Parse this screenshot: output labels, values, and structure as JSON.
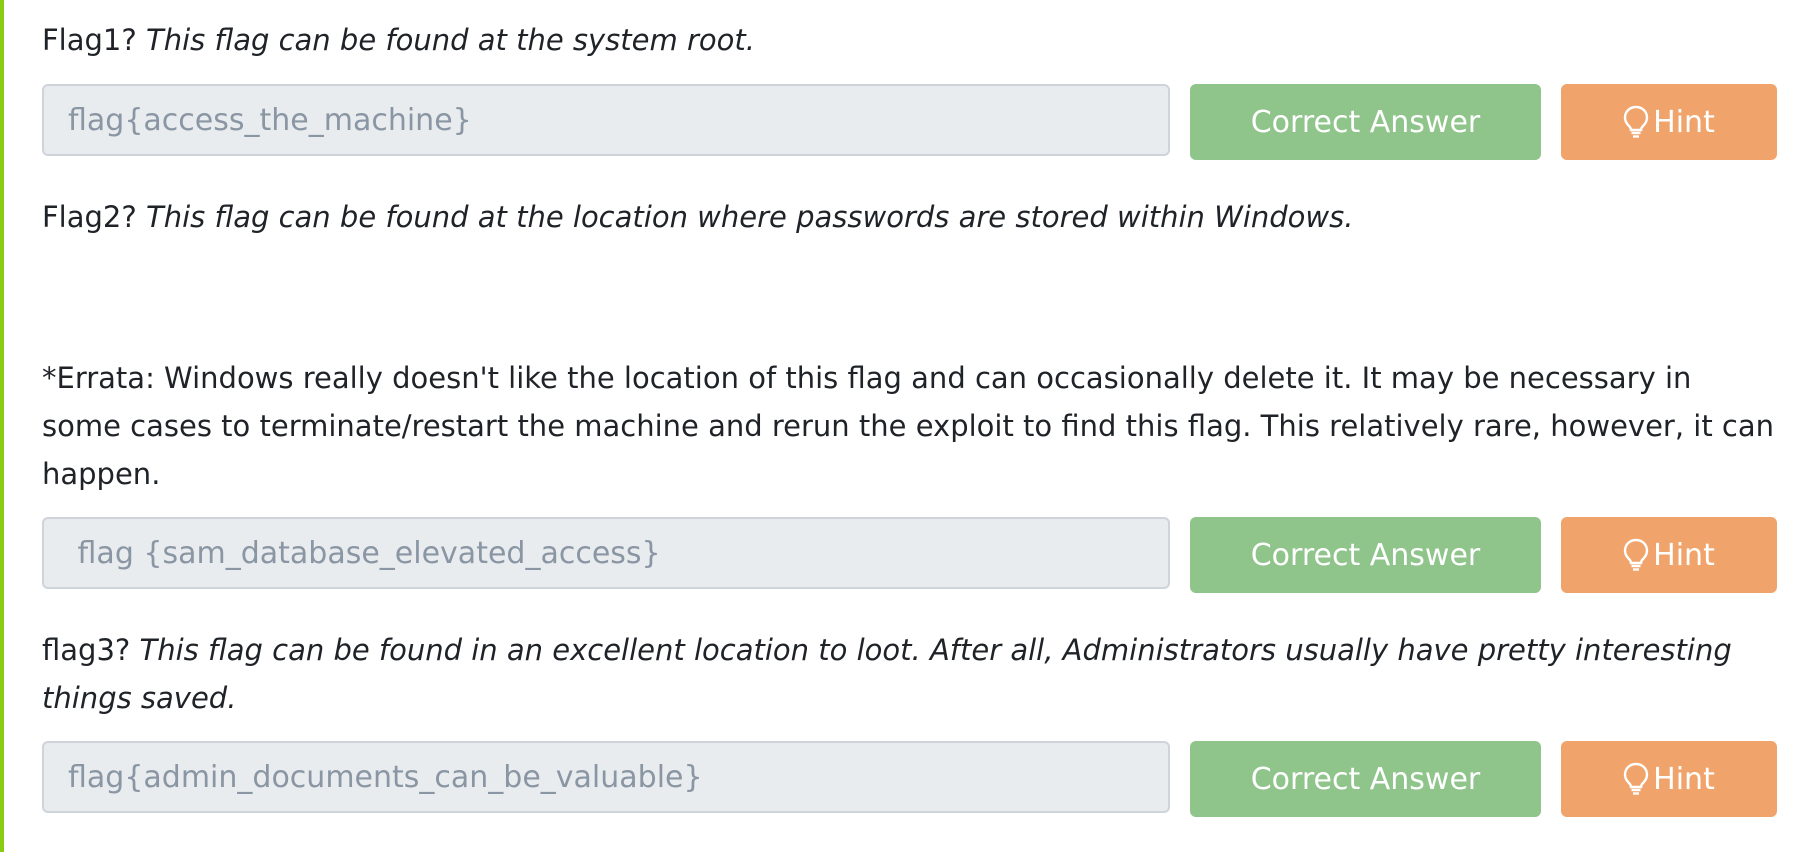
{
  "colors": {
    "accent_bar": "#88cc14",
    "correct_button": "#8fc48b",
    "hint_button": "#f0a46c",
    "input_bg": "#e9ecef",
    "input_text": "#8a96a3"
  },
  "questions": [
    {
      "label": "Flag1?",
      "text": "This flag can be found at the system root.",
      "answer": "flag{access_the_machine}",
      "correct_label": "Correct Answer",
      "hint_label": "Hint",
      "hint_icon": "lightbulb-icon"
    },
    {
      "label": "Flag2?",
      "text": "This flag can be found at the location where passwords are stored within Windows.",
      "errata": "*Errata: Windows really doesn't like the location of this flag and can occasionally delete it. It may be necessary in some cases to terminate/restart the machine and rerun the exploit to find this flag. This relatively rare, however, it can happen.",
      "answer": " flag {sam_database_elevated_access}",
      "correct_label": "Correct Answer",
      "hint_label": "Hint",
      "hint_icon": "lightbulb-icon"
    },
    {
      "label": "flag3?",
      "text": "This flag can be found in an excellent location to loot. After all, Administrators usually have pretty interesting things saved.",
      "answer": "flag{admin_documents_can_be_valuable}",
      "correct_label": "Correct Answer",
      "hint_label": "Hint",
      "hint_icon": "lightbulb-icon"
    }
  ]
}
